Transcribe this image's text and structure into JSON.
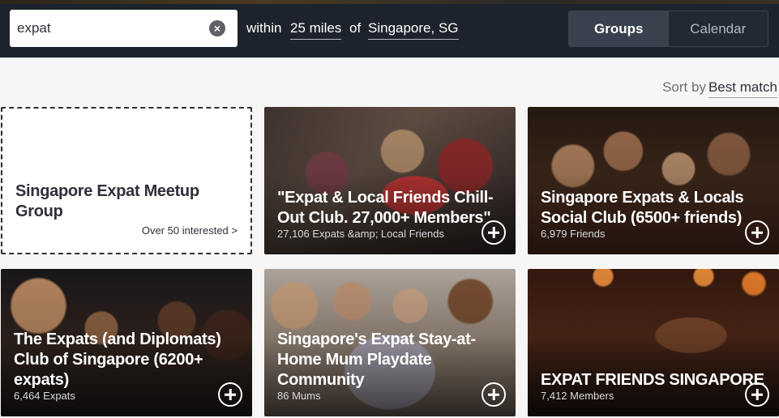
{
  "search": {
    "value": "expat",
    "clear_icon": "clear-circle-icon"
  },
  "location": {
    "within_label": "within",
    "radius": "25 miles",
    "of_label": "of",
    "city": "Singapore, SG"
  },
  "view_toggle": {
    "groups": "Groups",
    "calendar": "Calendar",
    "active": "Groups"
  },
  "sort": {
    "label": "Sort by",
    "value": "Best match"
  },
  "cards": [
    {
      "title": "Singapore Expat Meetup Group",
      "meta": "Over 50 interested >",
      "style": "placeholder"
    },
    {
      "title": "\"Expat & Local Friends Chill-Out Club. 27,000+ Members\"",
      "meta": "27,106 Expats &amp; Local Friends",
      "join_icon": "plus-circle-icon"
    },
    {
      "title": "Singapore Expats & Locals Social Club (6500+ friends)",
      "meta": "6,979 Friends",
      "join_icon": "plus-circle-icon"
    },
    {
      "title": "The Expats (and Diplomats) Club of Singapore (6200+ expats)",
      "meta": "6,464 Expats",
      "join_icon": "plus-circle-icon"
    },
    {
      "title": "Singapore's Expat Stay-at-Home Mum Playdate Community",
      "meta": "86 Mums",
      "join_icon": "plus-circle-icon"
    },
    {
      "title": "EXPAT FRIENDS SINGAPORE",
      "meta": "7,412 Members",
      "join_icon": "plus-circle-icon"
    }
  ],
  "colors": {
    "header_bg": "#1c232c",
    "page_bg": "#f6f6f6",
    "text_dark": "#2e3039"
  }
}
